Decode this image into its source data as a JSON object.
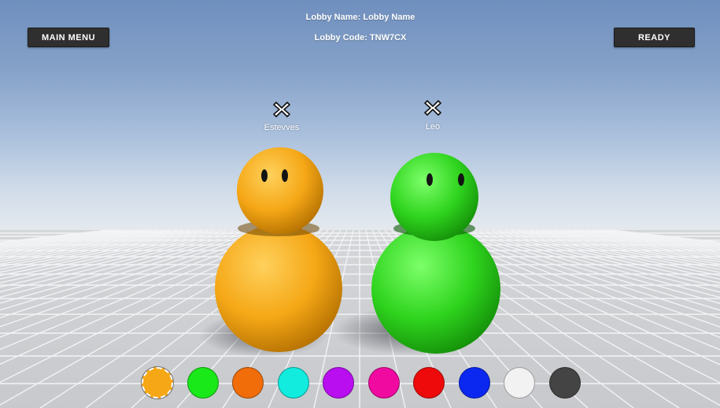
{
  "lobby": {
    "name_line": "Lobby Name: Lobby Name",
    "code_line": "Lobby Code: TNW7CX"
  },
  "buttons": {
    "main_menu": "MAIN MENU",
    "ready": "READY"
  },
  "players": [
    {
      "name": "Estevves",
      "color": "#f5a716",
      "kick_icon": "close-icon"
    },
    {
      "name": "Leo",
      "color": "#2fd41e",
      "kick_icon": "close-icon"
    }
  ],
  "palette": {
    "selected_index": 0,
    "colors": [
      "#f5a716",
      "#19e819",
      "#f06d0a",
      "#12ecdf",
      "#b90ef0",
      "#f00aa0",
      "#ee0a0a",
      "#0a28f0",
      "#f2f2f2",
      "#444444"
    ]
  }
}
